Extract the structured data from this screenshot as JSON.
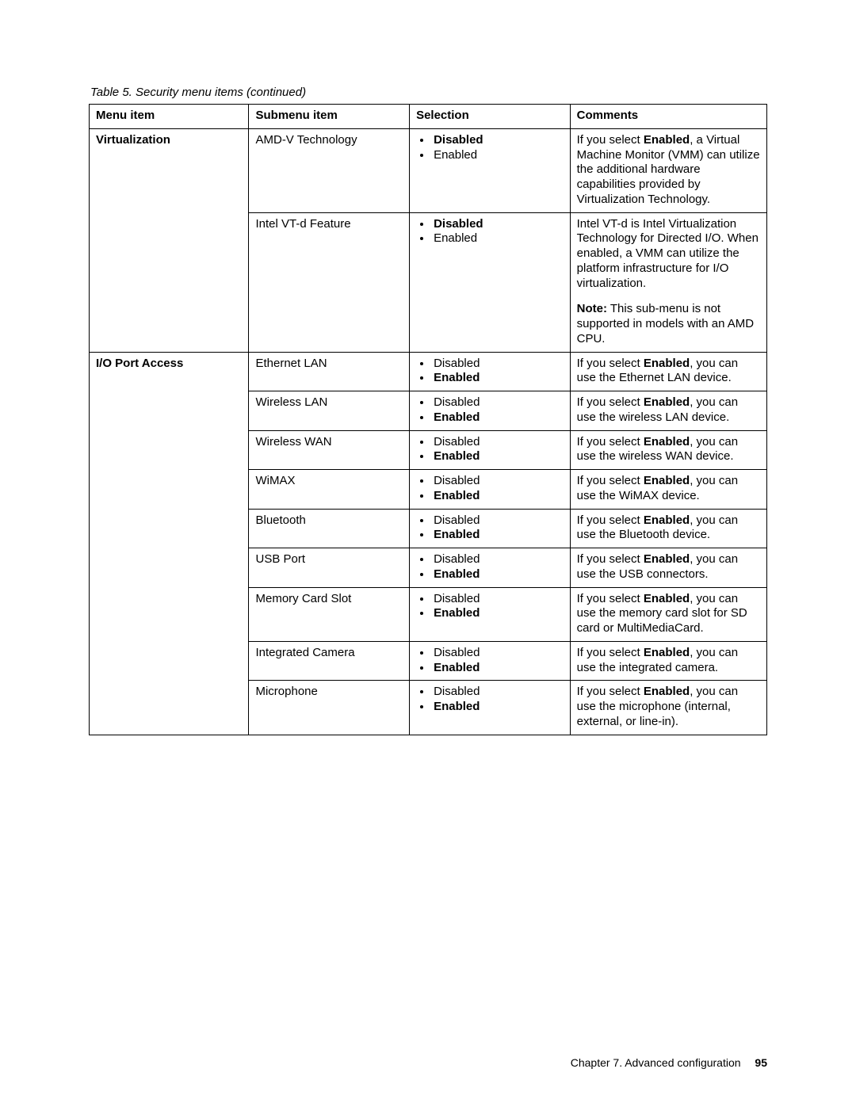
{
  "caption": "Table 5.  Security menu items (continued)",
  "headers": {
    "c1": "Menu item",
    "c2": "Submenu item",
    "c3": "Selection",
    "c4": "Comments"
  },
  "menu1": "Virtualization",
  "menu2": "I/O Port Access",
  "virt": {
    "amd": {
      "sub": "AMD-V Technology",
      "s1": "Disabled",
      "s2": "Enabled",
      "c_a": "If you select ",
      "c_b": "Enabled",
      "c_c": ", a Virtual Machine Monitor (VMM) can utilize the additional hardware capabilities provided by Virtualization Technology."
    },
    "vtd": {
      "sub": "Intel VT-d Feature",
      "s1": "Disabled",
      "s2": "Enabled",
      "c": "Intel VT-d is Intel Virtualization Technology for Directed I/O. When enabled, a VMM can utilize the platform infrastructure for I/O virtualization.",
      "note_label": "Note:",
      "note_text": " This sub-menu is not supported in models with an AMD CPU."
    }
  },
  "io": {
    "eth": {
      "sub": "Ethernet LAN",
      "s1": "Disabled",
      "s2": "Enabled",
      "ca": "If you select ",
      "cb": "Enabled",
      "cc": ", you can use the Ethernet LAN device."
    },
    "wlan": {
      "sub": "Wireless LAN",
      "s1": "Disabled",
      "s2": "Enabled",
      "ca": "If you select ",
      "cb": "Enabled",
      "cc": ", you can use the wireless LAN device."
    },
    "wwan": {
      "sub": "Wireless WAN",
      "s1": "Disabled",
      "s2": "Enabled",
      "ca": "If you select ",
      "cb": "Enabled",
      "cc": ", you can use the wireless WAN device."
    },
    "wimax": {
      "sub": "WiMAX",
      "s1": "Disabled",
      "s2": "Enabled",
      "ca": "If you select ",
      "cb": "Enabled",
      "cc": ", you can use the WiMAX device."
    },
    "bt": {
      "sub": "Bluetooth",
      "s1": "Disabled",
      "s2": "Enabled",
      "ca": "If you select ",
      "cb": "Enabled",
      "cc": ", you can use the Bluetooth device."
    },
    "usb": {
      "sub": "USB Port",
      "s1": "Disabled",
      "s2": "Enabled",
      "ca": "If you select ",
      "cb": "Enabled",
      "cc": ", you can use the USB connectors."
    },
    "mem": {
      "sub": "Memory Card Slot",
      "s1": "Disabled",
      "s2": "Enabled",
      "ca": "If you select ",
      "cb": "Enabled",
      "cc": ", you can use the memory card slot for SD card or MultiMediaCard."
    },
    "cam": {
      "sub": "Integrated Camera",
      "s1": "Disabled",
      "s2": "Enabled",
      "ca": "If you select ",
      "cb": "Enabled",
      "cc": ", you can use the integrated camera."
    },
    "mic": {
      "sub": "Microphone",
      "s1": "Disabled",
      "s2": "Enabled",
      "ca": "If you select ",
      "cb": "Enabled",
      "cc": ", you can use the microphone (internal, external, or line-in)."
    }
  },
  "footer": {
    "chapter": "Chapter 7. Advanced configuration",
    "page": "95"
  }
}
